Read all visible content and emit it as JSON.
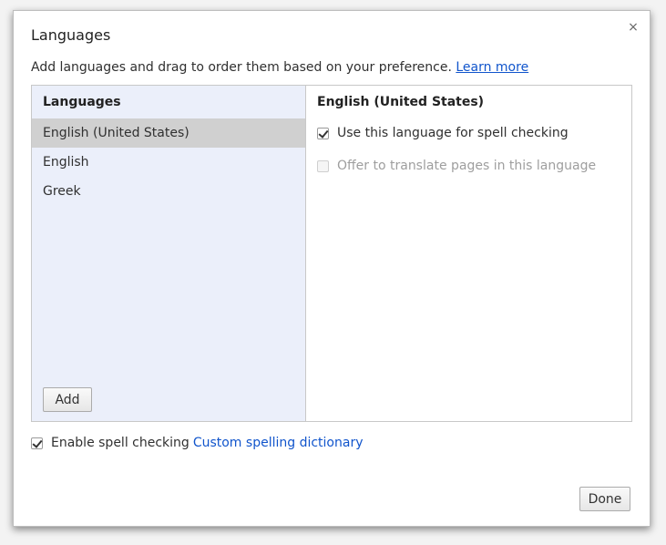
{
  "dialog": {
    "title": "Languages",
    "close_glyph": "×",
    "description": "Add languages and drag to order them based on your preference.",
    "learn_more": "Learn more"
  },
  "list_pane": {
    "header": "Languages",
    "items": [
      {
        "label": "English (United States)",
        "selected": true
      },
      {
        "label": "English",
        "selected": false
      },
      {
        "label": "Greek",
        "selected": false
      }
    ],
    "add_label": "Add"
  },
  "detail_pane": {
    "header": "English (United States)",
    "spellcheck_option": {
      "label": "Use this language for spell checking",
      "checked": true,
      "enabled": true
    },
    "translate_option": {
      "label": "Offer to translate pages in this language",
      "checked": false,
      "enabled": false
    }
  },
  "footer": {
    "enable_spell": {
      "label": "Enable spell checking",
      "checked": true
    },
    "custom_dictionary": "Custom spelling dictionary",
    "done_label": "Done"
  },
  "colors": {
    "link": "#1155cc",
    "list_background": "#ebeffa",
    "selected_item": "#d0d0d0"
  }
}
